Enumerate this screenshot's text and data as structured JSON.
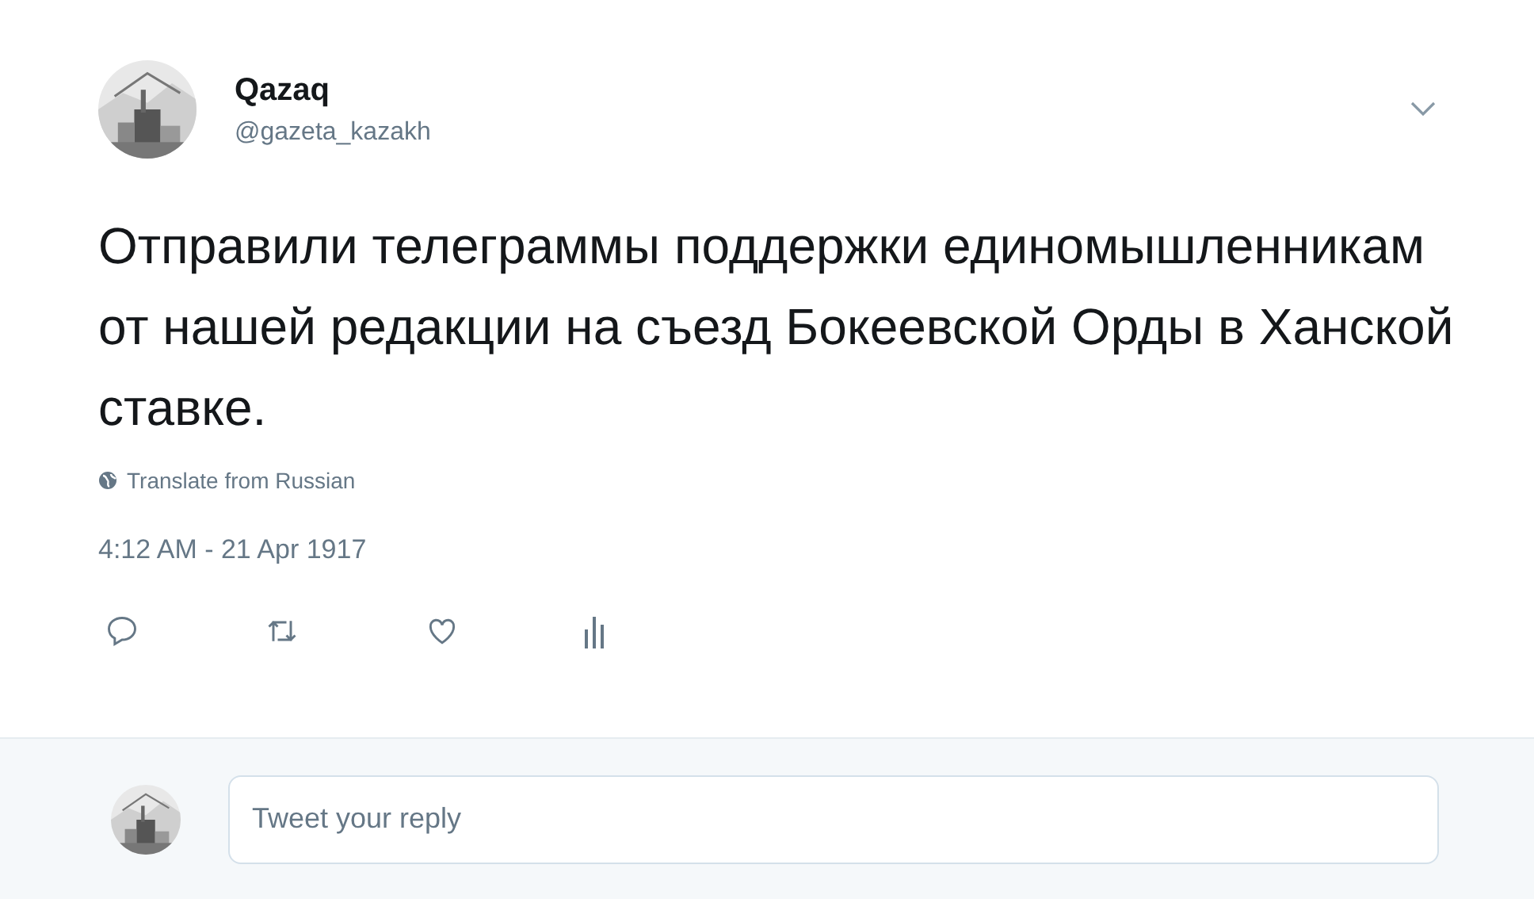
{
  "author": {
    "name": "Qazaq",
    "handle": "@gazeta_kazakh"
  },
  "tweet": {
    "text": "Отправили телеграммы поддержки единомышленникам от нашей редакции на съезд Бокеевской Орды в Ханской ставке.",
    "translate": "Translate from Russian",
    "timestamp": "4:12 AM - 21 Apr 1917"
  },
  "actions": [
    {
      "kind": "reply"
    },
    {
      "kind": "retweet"
    },
    {
      "kind": "like"
    },
    {
      "kind": "analytics"
    }
  ],
  "reply": {
    "placeholder": "Tweet your reply"
  }
}
